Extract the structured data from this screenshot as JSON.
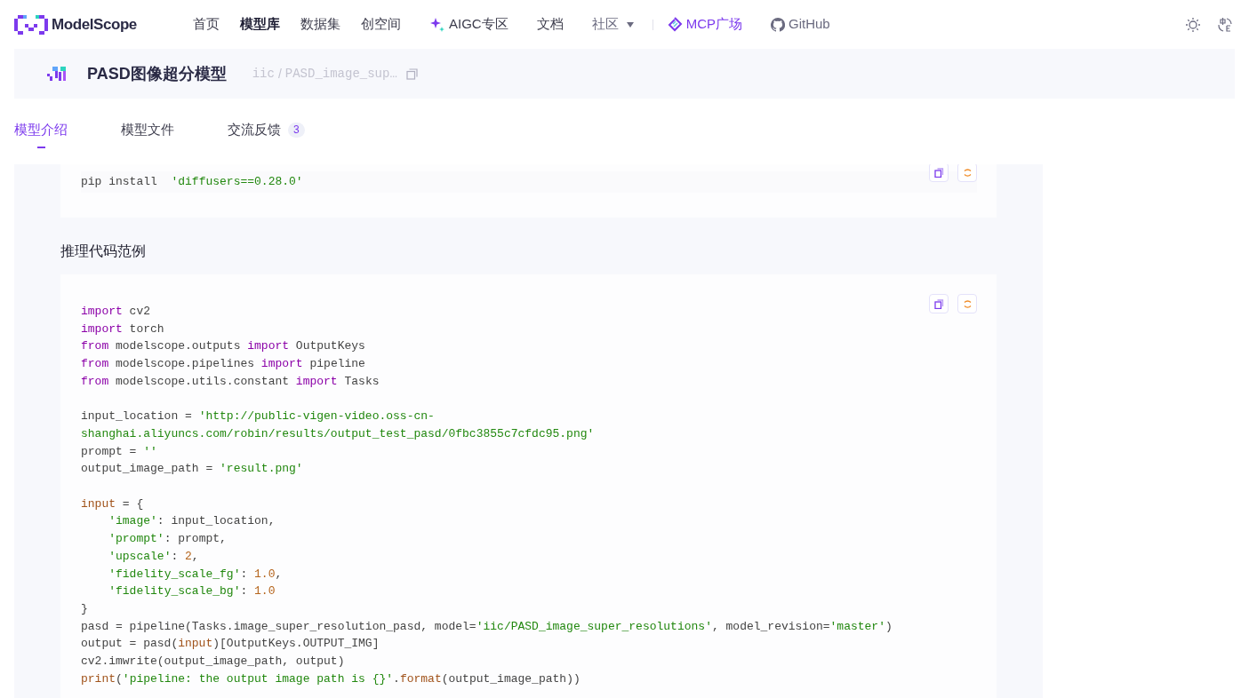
{
  "nav": {
    "logo": "ModelScope",
    "items": [
      {
        "label": "首页",
        "selected": false,
        "kind": "plain"
      },
      {
        "label": "模型库",
        "selected": true,
        "kind": "plain"
      },
      {
        "label": "数据集",
        "selected": false,
        "kind": "plain"
      },
      {
        "label": "创空间",
        "selected": false,
        "kind": "plain"
      },
      {
        "label": "AIGC专区",
        "selected": false,
        "kind": "aigc"
      },
      {
        "label": "文档",
        "selected": false,
        "kind": "plain"
      },
      {
        "label": "社区",
        "selected": false,
        "kind": "dropdown"
      },
      {
        "label": "MCP广场",
        "selected": false,
        "kind": "mcp"
      },
      {
        "label": "GitHub",
        "selected": false,
        "kind": "github"
      }
    ]
  },
  "model_header": {
    "title": "PASD图像超分模型",
    "namespace": "iic",
    "separator": "/",
    "path": "PASD_image_sup…"
  },
  "tabs": [
    {
      "label": "模型介绍",
      "selected": true
    },
    {
      "label": "模型文件",
      "selected": false
    },
    {
      "label": "交流反馈",
      "selected": false,
      "count": "3"
    }
  ],
  "content": {
    "install_block": {
      "lines": [
        {
          "kind": "code",
          "tokens": [
            {
              "t": "pip install  ",
              "kind": "plain"
            },
            {
              "t": "'diffusers==0.28.0'",
              "kind": "str"
            }
          ]
        }
      ]
    },
    "heading": "推理代码范例",
    "code_block": {
      "lines": [
        {
          "kind": "code",
          "tokens": [
            {
              "t": "import",
              "kind": "kw"
            },
            {
              "t": " cv2",
              "kind": "plain"
            }
          ]
        },
        {
          "kind": "code",
          "tokens": [
            {
              "t": "import",
              "kind": "kw"
            },
            {
              "t": " torch",
              "kind": "plain"
            }
          ]
        },
        {
          "kind": "code",
          "tokens": [
            {
              "t": "from",
              "kind": "kw"
            },
            {
              "t": " modelscope.outputs ",
              "kind": "plain"
            },
            {
              "t": "import",
              "kind": "kw"
            },
            {
              "t": " OutputKeys",
              "kind": "plain"
            }
          ]
        },
        {
          "kind": "code",
          "tokens": [
            {
              "t": "from",
              "kind": "kw"
            },
            {
              "t": " modelscope.pipelines ",
              "kind": "plain"
            },
            {
              "t": "import",
              "kind": "kw"
            },
            {
              "t": " pipeline",
              "kind": "plain"
            }
          ]
        },
        {
          "kind": "code",
          "tokens": [
            {
              "t": "from",
              "kind": "kw"
            },
            {
              "t": " modelscope.utils.constant ",
              "kind": "plain"
            },
            {
              "t": "import",
              "kind": "kw"
            },
            {
              "t": " Tasks",
              "kind": "plain"
            }
          ]
        },
        {
          "kind": "blank"
        },
        {
          "kind": "code",
          "tokens": [
            {
              "t": "input_location = ",
              "kind": "plain"
            },
            {
              "t": "'http://public-vigen-video.oss-cn-",
              "kind": "str"
            }
          ]
        },
        {
          "kind": "code",
          "tokens": [
            {
              "t": "shanghai.aliyuncs.com/robin/results/output_test_pasd/0fbc3855c7cfdc95.png'",
              "kind": "str"
            }
          ]
        },
        {
          "kind": "code",
          "tokens": [
            {
              "t": "prompt = ",
              "kind": "plain"
            },
            {
              "t": "''",
              "kind": "str"
            }
          ]
        },
        {
          "kind": "code",
          "tokens": [
            {
              "t": "output_image_path = ",
              "kind": "plain"
            },
            {
              "t": "'result.png'",
              "kind": "str"
            }
          ]
        },
        {
          "kind": "blank"
        },
        {
          "kind": "code",
          "tokens": [
            {
              "t": "input",
              "kind": "builtin"
            },
            {
              "t": " = {",
              "kind": "plain"
            }
          ]
        },
        {
          "kind": "indented",
          "tokens": [
            {
              "t": "'image'",
              "kind": "str"
            },
            {
              "t": ": input_location,",
              "kind": "plain"
            }
          ]
        },
        {
          "kind": "indented",
          "tokens": [
            {
              "t": "'prompt'",
              "kind": "str"
            },
            {
              "t": ": prompt,",
              "kind": "plain"
            }
          ]
        },
        {
          "kind": "indented",
          "tokens": [
            {
              "t": "'upscale'",
              "kind": "str"
            },
            {
              "t": ": ",
              "kind": "plain"
            },
            {
              "t": "2",
              "kind": "num"
            },
            {
              "t": ",",
              "kind": "plain"
            }
          ]
        },
        {
          "kind": "indented",
          "tokens": [
            {
              "t": "'fidelity_scale_fg'",
              "kind": "str"
            },
            {
              "t": ": ",
              "kind": "plain"
            },
            {
              "t": "1.0",
              "kind": "num"
            },
            {
              "t": ",",
              "kind": "plain"
            }
          ]
        },
        {
          "kind": "indented",
          "tokens": [
            {
              "t": "'fidelity_scale_bg'",
              "kind": "str"
            },
            {
              "t": ": ",
              "kind": "plain"
            },
            {
              "t": "1.0",
              "kind": "num"
            }
          ]
        },
        {
          "kind": "code",
          "tokens": [
            {
              "t": "}",
              "kind": "plain"
            }
          ]
        },
        {
          "kind": "code",
          "tokens": [
            {
              "t": "pasd = pipeline(Tasks.image_super_resolution_pasd, model=",
              "kind": "plain"
            },
            {
              "t": "'iic/PASD_image_super_resolutions'",
              "kind": "str"
            },
            {
              "t": ", model_revision=",
              "kind": "plain"
            },
            {
              "t": "'master'",
              "kind": "str"
            },
            {
              "t": ")",
              "kind": "plain"
            }
          ]
        },
        {
          "kind": "code",
          "tokens": [
            {
              "t": "output = pasd(",
              "kind": "plain"
            },
            {
              "t": "input",
              "kind": "builtin"
            },
            {
              "t": ")[OutputKeys.OUTPUT_IMG]",
              "kind": "plain"
            }
          ]
        },
        {
          "kind": "code",
          "tokens": [
            {
              "t": "cv2.imwrite(output_image_path, output)",
              "kind": "plain"
            }
          ]
        },
        {
          "kind": "code",
          "tokens": [
            {
              "t": "print",
              "kind": "builtin"
            },
            {
              "t": "(",
              "kind": "plain"
            },
            {
              "t": "'pipeline: the output image path is {}'",
              "kind": "str"
            },
            {
              "t": ".",
              "kind": "plain"
            },
            {
              "t": "format",
              "kind": "builtin"
            },
            {
              "t": "(output_image_path))",
              "kind": "plain"
            }
          ]
        }
      ]
    }
  }
}
